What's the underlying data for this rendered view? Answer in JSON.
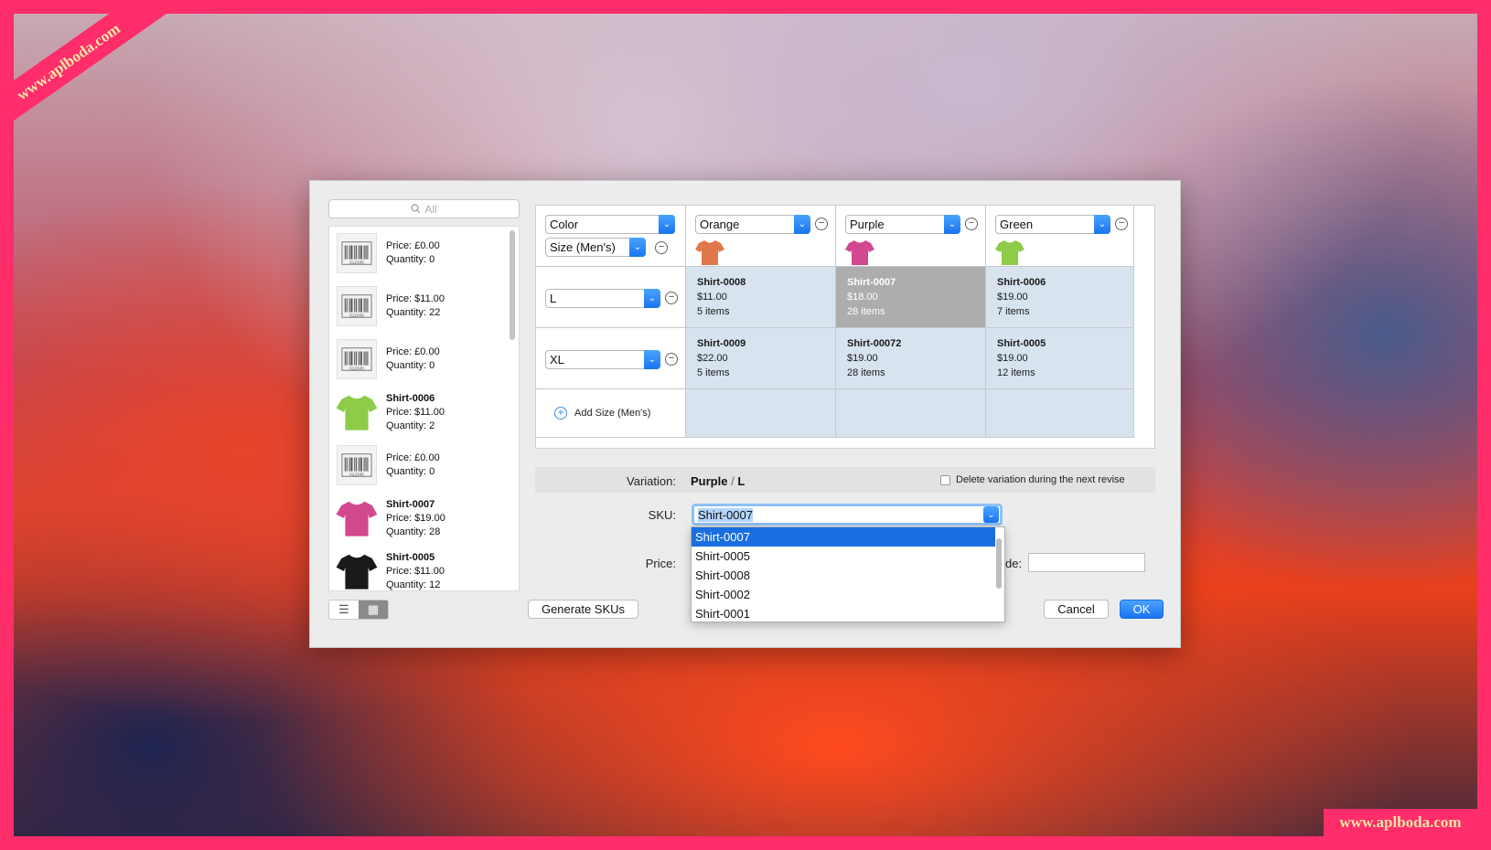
{
  "watermark": {
    "ribbon": "www.aplboda.com",
    "corner": "www.aplboda.com"
  },
  "search": {
    "placeholder": "All"
  },
  "items": [
    {
      "name": "",
      "price": "Price: £0.00",
      "quantity": "Quantity: 0",
      "icon": "barcode-icon",
      "barcode_number": "012345"
    },
    {
      "name": "",
      "price": "Price: $11.00",
      "quantity": "Quantity: 22",
      "icon": "barcode-icon",
      "barcode_number": "012345"
    },
    {
      "name": "",
      "price": "Price: £0.00",
      "quantity": "Quantity: 0",
      "icon": "barcode-icon",
      "barcode_number": "012345"
    },
    {
      "name": "Shirt-0006",
      "price": "Price: $11.00",
      "quantity": "Quantity: 2",
      "icon": "green-shirt-icon",
      "color": "#8dcb48"
    },
    {
      "name": "",
      "price": "Price: £0.00",
      "quantity": "Quantity: 0",
      "icon": "barcode-icon",
      "barcode_number": "012345"
    },
    {
      "name": "Shirt-0007",
      "price": "Price: $19.00",
      "quantity": "Quantity: 28",
      "icon": "purple-shirt-icon",
      "color": "#d2488f"
    },
    {
      "name": "Shirt-0005",
      "price": "Price: $11.00",
      "quantity": "Quantity: 12",
      "icon": "black-shirt-icon",
      "color": "#1a1a1a"
    }
  ],
  "grid": {
    "row_attribute": "Color",
    "col_attribute": "Size (Men's)",
    "colors": [
      {
        "name": "Orange",
        "hex": "#e0784a"
      },
      {
        "name": "Purple",
        "hex": "#d2488f"
      },
      {
        "name": "Green",
        "hex": "#8dcb48"
      }
    ],
    "sizes": [
      "L",
      "XL"
    ],
    "add_size_label": "Add Size (Men's)",
    "cells": [
      [
        {
          "sku": "Shirt-0008",
          "price": "$11.00",
          "items": "5 items"
        },
        {
          "sku": "Shirt-0007",
          "price": "$18.00",
          "items": "28 items"
        },
        {
          "sku": "Shirt-0006",
          "price": "$19.00",
          "items": "7 items"
        }
      ],
      [
        {
          "sku": "Shirt-0009",
          "price": "$22.00",
          "items": "5 items"
        },
        {
          "sku": "Shirt-00072",
          "price": "$19.00",
          "items": "28 items"
        },
        {
          "sku": "Shirt-0005",
          "price": "$19.00",
          "items": "12 items"
        }
      ]
    ]
  },
  "form": {
    "variation_label": "Variation:",
    "variation_color": "Purple",
    "variation_sep": "/",
    "variation_size": "L",
    "delete_label": "Delete variation during the next revise",
    "sku_label": "SKU:",
    "sku_value": "Shirt-0007",
    "sku_options": [
      "Shirt-0007",
      "Shirt-0005",
      "Shirt-0008",
      "Shirt-0002",
      "Shirt-0001"
    ],
    "price_label": "Price:",
    "cut_label": "de:"
  },
  "buttons": {
    "generate": "Generate SKUs",
    "cancel": "Cancel",
    "ok": "OK"
  }
}
